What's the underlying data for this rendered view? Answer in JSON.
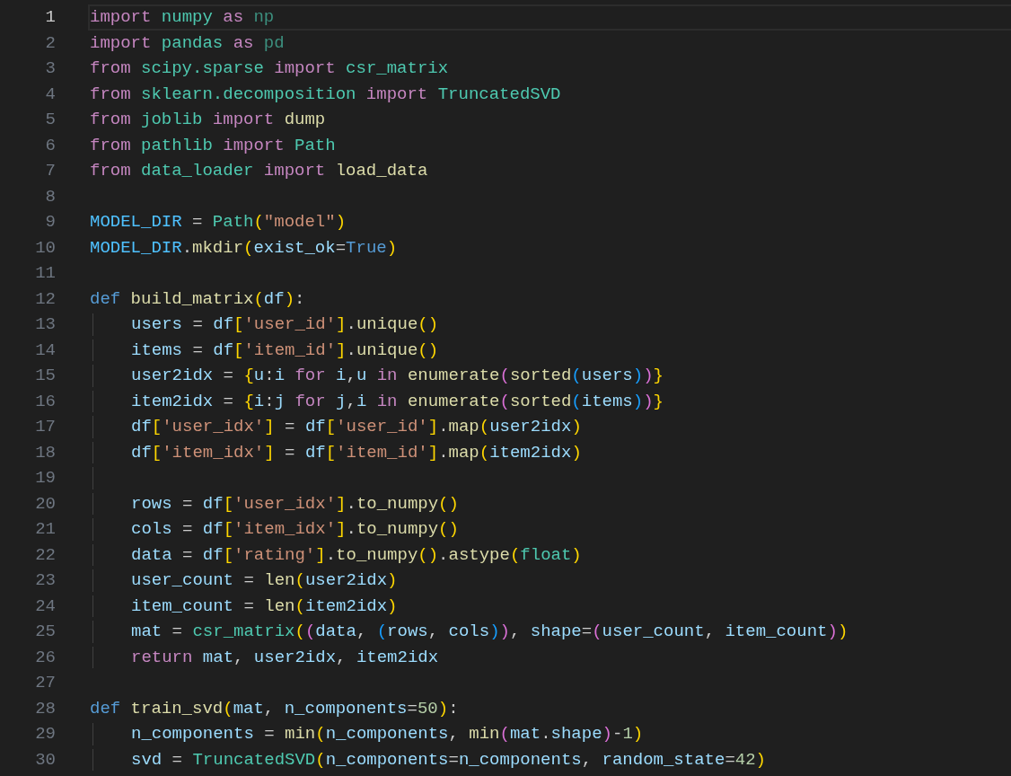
{
  "editor": {
    "lines": [
      {
        "number": "1",
        "current": true,
        "tokens": [
          {
            "text": "import",
            "kind": "keyword"
          },
          {
            "text": " numpy",
            "kind": "module"
          },
          {
            "text": " as",
            "kind": "keyword"
          },
          {
            "text": " np",
            "kind": "alias"
          }
        ]
      },
      {
        "number": "2",
        "current": false,
        "tokens": [
          {
            "text": "import",
            "kind": "keyword"
          },
          {
            "text": " pandas",
            "kind": "module"
          },
          {
            "text": " as",
            "kind": "keyword"
          },
          {
            "text": " pd",
            "kind": "alias"
          }
        ]
      },
      {
        "number": "3",
        "current": false,
        "tokens": [
          {
            "text": "from",
            "kind": "keyword"
          },
          {
            "text": " scipy.sparse",
            "kind": "module"
          },
          {
            "text": " import",
            "kind": "keyword"
          },
          {
            "text": " csr_matrix",
            "kind": "module"
          }
        ]
      },
      {
        "number": "4",
        "current": false,
        "tokens": [
          {
            "text": "from",
            "kind": "keyword"
          },
          {
            "text": " sklearn.decomposition",
            "kind": "module"
          },
          {
            "text": " import",
            "kind": "keyword"
          },
          {
            "text": " TruncatedSVD",
            "kind": "module"
          }
        ]
      },
      {
        "number": "5",
        "current": false,
        "tokens": [
          {
            "text": "from",
            "kind": "keyword"
          },
          {
            "text": " joblib",
            "kind": "module"
          },
          {
            "text": " import",
            "kind": "keyword"
          },
          {
            "text": " dump",
            "kind": "function"
          }
        ]
      },
      {
        "number": "6",
        "current": false,
        "tokens": [
          {
            "text": "from",
            "kind": "keyword"
          },
          {
            "text": " pathlib",
            "kind": "module"
          },
          {
            "text": " import",
            "kind": "keyword"
          },
          {
            "text": " Path",
            "kind": "module"
          }
        ]
      },
      {
        "number": "7",
        "current": false,
        "tokens": [
          {
            "text": "from",
            "kind": "keyword"
          },
          {
            "text": " data_loader",
            "kind": "module"
          },
          {
            "text": " import",
            "kind": "keyword"
          },
          {
            "text": " load_data",
            "kind": "function"
          }
        ]
      },
      {
        "number": "8",
        "current": false
      },
      {
        "number": "9",
        "current": false,
        "tokens": [
          {
            "text": "MODEL_DIR",
            "kind": "constant"
          },
          {
            "text": " = ",
            "kind": "punct"
          },
          {
            "text": "Path",
            "kind": "module"
          },
          {
            "text": "(",
            "kind": "bracket1"
          },
          {
            "text": "\"model\"",
            "kind": "string"
          },
          {
            "text": ")",
            "kind": "bracket1"
          }
        ]
      },
      {
        "number": "10",
        "current": false,
        "tokens": [
          {
            "text": "MODEL_DIR",
            "kind": "constant"
          },
          {
            "text": ".",
            "kind": "punct"
          },
          {
            "text": "mkdir",
            "kind": "function"
          },
          {
            "text": "(",
            "kind": "bracket1"
          },
          {
            "text": "exist_ok",
            "kind": "variable"
          },
          {
            "text": "=",
            "kind": "punct"
          },
          {
            "text": "True",
            "kind": "storage"
          },
          {
            "text": ")",
            "kind": "bracket1"
          }
        ]
      },
      {
        "number": "11",
        "current": false
      },
      {
        "number": "12",
        "current": false,
        "tokens": [
          {
            "text": "def ",
            "kind": "storage"
          },
          {
            "text": "build_matrix",
            "kind": "function"
          },
          {
            "text": "(",
            "kind": "bracket1"
          },
          {
            "text": "df",
            "kind": "variable"
          },
          {
            "text": ")",
            "kind": "bracket1"
          },
          {
            "text": ":",
            "kind": "punct"
          }
        ],
        "children": [
          {
            "number": "13",
            "current": false,
            "tokens": [
              {
                "text": "users",
                "kind": "variable"
              },
              {
                "text": " = ",
                "kind": "punct"
              },
              {
                "text": "df",
                "kind": "variable"
              },
              {
                "text": "[",
                "kind": "bracket1"
              },
              {
                "text": "'user_id'",
                "kind": "string"
              },
              {
                "text": "]",
                "kind": "bracket1"
              },
              {
                "text": ".",
                "kind": "punct"
              },
              {
                "text": "unique",
                "kind": "function"
              },
              {
                "text": "()",
                "kind": "bracket1"
              }
            ]
          },
          {
            "number": "14",
            "current": false,
            "tokens": [
              {
                "text": "items",
                "kind": "variable"
              },
              {
                "text": " = ",
                "kind": "punct"
              },
              {
                "text": "df",
                "kind": "variable"
              },
              {
                "text": "[",
                "kind": "bracket1"
              },
              {
                "text": "'item_id'",
                "kind": "string"
              },
              {
                "text": "]",
                "kind": "bracket1"
              },
              {
                "text": ".",
                "kind": "punct"
              },
              {
                "text": "unique",
                "kind": "function"
              },
              {
                "text": "()",
                "kind": "bracket1"
              }
            ]
          },
          {
            "number": "15",
            "current": false,
            "tokens": [
              {
                "text": "user2idx",
                "kind": "variable"
              },
              {
                "text": " = ",
                "kind": "punct"
              },
              {
                "text": "{",
                "kind": "bracket1"
              },
              {
                "text": "u",
                "kind": "variable"
              },
              {
                "text": ":",
                "kind": "punct"
              },
              {
                "text": "i",
                "kind": "variable"
              },
              {
                "text": " for",
                "kind": "keyword"
              },
              {
                "text": " i",
                "kind": "variable"
              },
              {
                "text": ",",
                "kind": "punct"
              },
              {
                "text": "u",
                "kind": "variable"
              },
              {
                "text": " in ",
                "kind": "keyword"
              },
              {
                "text": "enumerate",
                "kind": "function"
              },
              {
                "text": "(",
                "kind": "bracket2"
              },
              {
                "text": "sorted",
                "kind": "function"
              },
              {
                "text": "(",
                "kind": "bracket3"
              },
              {
                "text": "users",
                "kind": "variable"
              },
              {
                "text": ")",
                "kind": "bracket3"
              },
              {
                "text": ")",
                "kind": "bracket2"
              },
              {
                "text": "}",
                "kind": "bracket1"
              }
            ]
          },
          {
            "number": "16",
            "current": false,
            "tokens": [
              {
                "text": "item2idx",
                "kind": "variable"
              },
              {
                "text": " = ",
                "kind": "punct"
              },
              {
                "text": "{",
                "kind": "bracket1"
              },
              {
                "text": "i",
                "kind": "variable"
              },
              {
                "text": ":",
                "kind": "punct"
              },
              {
                "text": "j",
                "kind": "variable"
              },
              {
                "text": " for",
                "kind": "keyword"
              },
              {
                "text": " j",
                "kind": "variable"
              },
              {
                "text": ",",
                "kind": "punct"
              },
              {
                "text": "i",
                "kind": "variable"
              },
              {
                "text": " in ",
                "kind": "keyword"
              },
              {
                "text": "enumerate",
                "kind": "function"
              },
              {
                "text": "(",
                "kind": "bracket2"
              },
              {
                "text": "sorted",
                "kind": "function"
              },
              {
                "text": "(",
                "kind": "bracket3"
              },
              {
                "text": "items",
                "kind": "variable"
              },
              {
                "text": ")",
                "kind": "bracket3"
              },
              {
                "text": ")",
                "kind": "bracket2"
              },
              {
                "text": "}",
                "kind": "bracket1"
              }
            ]
          },
          {
            "number": "17",
            "current": false,
            "tokens": [
              {
                "text": "df",
                "kind": "variable"
              },
              {
                "text": "[",
                "kind": "bracket1"
              },
              {
                "text": "'user_idx'",
                "kind": "string"
              },
              {
                "text": "]",
                "kind": "bracket1"
              },
              {
                "text": " = ",
                "kind": "punct"
              },
              {
                "text": "df",
                "kind": "variable"
              },
              {
                "text": "[",
                "kind": "bracket1"
              },
              {
                "text": "'user_id'",
                "kind": "string"
              },
              {
                "text": "]",
                "kind": "bracket1"
              },
              {
                "text": ".",
                "kind": "punct"
              },
              {
                "text": "map",
                "kind": "function"
              },
              {
                "text": "(",
                "kind": "bracket1"
              },
              {
                "text": "user2idx",
                "kind": "variable"
              },
              {
                "text": ")",
                "kind": "bracket1"
              }
            ]
          },
          {
            "number": "18",
            "current": false,
            "tokens": [
              {
                "text": "df",
                "kind": "variable"
              },
              {
                "text": "[",
                "kind": "bracket1"
              },
              {
                "text": "'item_idx'",
                "kind": "string"
              },
              {
                "text": "]",
                "kind": "bracket1"
              },
              {
                "text": " = ",
                "kind": "punct"
              },
              {
                "text": "df",
                "kind": "variable"
              },
              {
                "text": "[",
                "kind": "bracket1"
              },
              {
                "text": "'item_id'",
                "kind": "string"
              },
              {
                "text": "]",
                "kind": "bracket1"
              },
              {
                "text": ".",
                "kind": "punct"
              },
              {
                "text": "map",
                "kind": "function"
              },
              {
                "text": "(",
                "kind": "bracket1"
              },
              {
                "text": "item2idx",
                "kind": "variable"
              },
              {
                "text": ")",
                "kind": "bracket1"
              }
            ]
          },
          {
            "number": "19",
            "current": false
          },
          {
            "number": "20",
            "current": false,
            "tokens": [
              {
                "text": "rows",
                "kind": "variable"
              },
              {
                "text": " = ",
                "kind": "punct"
              },
              {
                "text": "df",
                "kind": "variable"
              },
              {
                "text": "[",
                "kind": "bracket1"
              },
              {
                "text": "'user_idx'",
                "kind": "string"
              },
              {
                "text": "]",
                "kind": "bracket1"
              },
              {
                "text": ".",
                "kind": "punct"
              },
              {
                "text": "to_numpy",
                "kind": "function"
              },
              {
                "text": "()",
                "kind": "bracket1"
              }
            ]
          },
          {
            "number": "21",
            "current": false,
            "tokens": [
              {
                "text": "cols",
                "kind": "variable"
              },
              {
                "text": " = ",
                "kind": "punct"
              },
              {
                "text": "df",
                "kind": "variable"
              },
              {
                "text": "[",
                "kind": "bracket1"
              },
              {
                "text": "'item_idx'",
                "kind": "string"
              },
              {
                "text": "]",
                "kind": "bracket1"
              },
              {
                "text": ".",
                "kind": "punct"
              },
              {
                "text": "to_numpy",
                "kind": "function"
              },
              {
                "text": "()",
                "kind": "bracket1"
              }
            ]
          },
          {
            "number": "22",
            "current": false,
            "tokens": [
              {
                "text": "data",
                "kind": "variable"
              },
              {
                "text": " = ",
                "kind": "punct"
              },
              {
                "text": "df",
                "kind": "variable"
              },
              {
                "text": "[",
                "kind": "bracket1"
              },
              {
                "text": "'rating'",
                "kind": "string"
              },
              {
                "text": "]",
                "kind": "bracket1"
              },
              {
                "text": ".",
                "kind": "punct"
              },
              {
                "text": "to_numpy",
                "kind": "function"
              },
              {
                "text": "()",
                "kind": "bracket1"
              },
              {
                "text": ".",
                "kind": "punct"
              },
              {
                "text": "astype",
                "kind": "function"
              },
              {
                "text": "(",
                "kind": "bracket1"
              },
              {
                "text": "float",
                "kind": "module"
              },
              {
                "text": ")",
                "kind": "bracket1"
              }
            ]
          },
          {
            "number": "23",
            "current": false,
            "tokens": [
              {
                "text": "user_count",
                "kind": "variable"
              },
              {
                "text": " = ",
                "kind": "punct"
              },
              {
                "text": "len",
                "kind": "function"
              },
              {
                "text": "(",
                "kind": "bracket1"
              },
              {
                "text": "user2idx",
                "kind": "variable"
              },
              {
                "text": ")",
                "kind": "bracket1"
              }
            ]
          },
          {
            "number": "24",
            "current": false,
            "tokens": [
              {
                "text": "item_count",
                "kind": "variable"
              },
              {
                "text": " = ",
                "kind": "punct"
              },
              {
                "text": "len",
                "kind": "function"
              },
              {
                "text": "(",
                "kind": "bracket1"
              },
              {
                "text": "item2idx",
                "kind": "variable"
              },
              {
                "text": ")",
                "kind": "bracket1"
              }
            ]
          },
          {
            "number": "25",
            "current": false,
            "tokens": [
              {
                "text": "mat",
                "kind": "variable"
              },
              {
                "text": " = ",
                "kind": "punct"
              },
              {
                "text": "csr_matrix",
                "kind": "module"
              },
              {
                "text": "(",
                "kind": "bracket1"
              },
              {
                "text": "(",
                "kind": "bracket2"
              },
              {
                "text": "data",
                "kind": "variable"
              },
              {
                "text": ", ",
                "kind": "punct"
              },
              {
                "text": "(",
                "kind": "bracket3"
              },
              {
                "text": "rows",
                "kind": "variable"
              },
              {
                "text": ", ",
                "kind": "punct"
              },
              {
                "text": "cols",
                "kind": "variable"
              },
              {
                "text": ")",
                "kind": "bracket3"
              },
              {
                "text": ")",
                "kind": "bracket2"
              },
              {
                "text": ", ",
                "kind": "punct"
              },
              {
                "text": "shape",
                "kind": "variable"
              },
              {
                "text": "=",
                "kind": "punct"
              },
              {
                "text": "(",
                "kind": "bracket2"
              },
              {
                "text": "user_count",
                "kind": "variable"
              },
              {
                "text": ", ",
                "kind": "punct"
              },
              {
                "text": "item_count",
                "kind": "variable"
              },
              {
                "text": ")",
                "kind": "bracket2"
              },
              {
                "text": ")",
                "kind": "bracket1"
              }
            ]
          },
          {
            "number": "26",
            "current": false,
            "tokens": [
              {
                "text": "return",
                "kind": "keyword"
              },
              {
                "text": " mat",
                "kind": "variable"
              },
              {
                "text": ", ",
                "kind": "punct"
              },
              {
                "text": "user2idx",
                "kind": "variable"
              },
              {
                "text": ", ",
                "kind": "punct"
              },
              {
                "text": "item2idx",
                "kind": "variable"
              }
            ]
          }
        ]
      },
      {
        "number": "27",
        "current": false
      },
      {
        "number": "28",
        "current": false,
        "tokens": [
          {
            "text": "def ",
            "kind": "storage"
          },
          {
            "text": "train_svd",
            "kind": "function"
          },
          {
            "text": "(",
            "kind": "bracket1"
          },
          {
            "text": "mat",
            "kind": "variable"
          },
          {
            "text": ", ",
            "kind": "punct"
          },
          {
            "text": "n_components",
            "kind": "variable"
          },
          {
            "text": "=",
            "kind": "punct"
          },
          {
            "text": "50",
            "kind": "number"
          },
          {
            "text": ")",
            "kind": "bracket1"
          },
          {
            "text": ":",
            "kind": "punct"
          }
        ],
        "children": [
          {
            "number": "29",
            "current": false,
            "tokens": [
              {
                "text": "n_components",
                "kind": "variable"
              },
              {
                "text": " = ",
                "kind": "punct"
              },
              {
                "text": "min",
                "kind": "function"
              },
              {
                "text": "(",
                "kind": "bracket1"
              },
              {
                "text": "n_components",
                "kind": "variable"
              },
              {
                "text": ", ",
                "kind": "punct"
              },
              {
                "text": "min",
                "kind": "function"
              },
              {
                "text": "(",
                "kind": "bracket2"
              },
              {
                "text": "mat",
                "kind": "variable"
              },
              {
                "text": ".",
                "kind": "punct"
              },
              {
                "text": "shape",
                "kind": "variable"
              },
              {
                "text": ")",
                "kind": "bracket2"
              },
              {
                "text": "-",
                "kind": "punct"
              },
              {
                "text": "1",
                "kind": "number"
              },
              {
                "text": ")",
                "kind": "bracket1"
              }
            ]
          },
          {
            "number": "30",
            "current": false,
            "tokens": [
              {
                "text": "svd",
                "kind": "variable"
              },
              {
                "text": " = ",
                "kind": "punct"
              },
              {
                "text": "TruncatedSVD",
                "kind": "module"
              },
              {
                "text": "(",
                "kind": "bracket1"
              },
              {
                "text": "n_components",
                "kind": "variable"
              },
              {
                "text": "=",
                "kind": "punct"
              },
              {
                "text": "n_components",
                "kind": "variable"
              },
              {
                "text": ", ",
                "kind": "punct"
              },
              {
                "text": "random_state",
                "kind": "variable"
              },
              {
                "text": "=",
                "kind": "punct"
              },
              {
                "text": "42",
                "kind": "number"
              },
              {
                "text": ")",
                "kind": "bracket1"
              }
            ]
          }
        ]
      }
    ]
  }
}
